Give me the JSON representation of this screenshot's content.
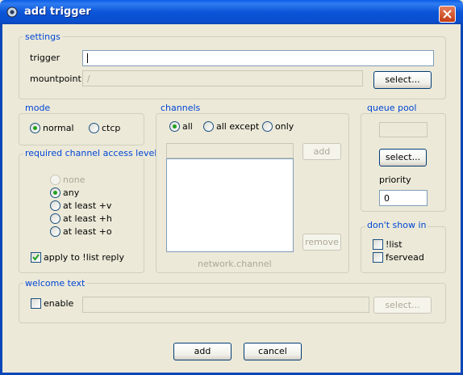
{
  "window": {
    "title": "add trigger"
  },
  "settings": {
    "legend": "settings",
    "trigger_label": "trigger",
    "trigger_value": "",
    "mountpoint_label": "mountpoint",
    "mountpoint_value": "/",
    "select_label": "select..."
  },
  "mode": {
    "legend": "mode",
    "options": [
      {
        "label": "normal",
        "selected": true
      },
      {
        "label": "ctcp",
        "selected": false
      }
    ]
  },
  "access": {
    "legend": "required channel access level",
    "options": [
      {
        "label": "none",
        "selected": false,
        "enabled": false
      },
      {
        "label": "any",
        "selected": true,
        "enabled": true
      },
      {
        "label": "at least +v",
        "selected": false,
        "enabled": true
      },
      {
        "label": "at least +h",
        "selected": false,
        "enabled": true
      },
      {
        "label": "at least +o",
        "selected": false,
        "enabled": true
      }
    ],
    "apply_label": "apply to !list reply",
    "apply_checked": true
  },
  "channels": {
    "legend": "channels",
    "options": [
      {
        "label": "all",
        "selected": true
      },
      {
        "label": "all except",
        "selected": false
      },
      {
        "label": "only",
        "selected": false
      }
    ],
    "add_label": "add",
    "remove_label": "remove",
    "hint": "network.channel"
  },
  "queue_pool": {
    "legend": "queue pool",
    "select_label": "select...",
    "priority_label": "priority",
    "priority_value": "0"
  },
  "dont_show": {
    "legend": "don't show in",
    "items": [
      {
        "label": "!list",
        "checked": false
      },
      {
        "label": "fservead",
        "checked": false
      }
    ]
  },
  "welcome": {
    "legend": "welcome text",
    "enable_label": "enable",
    "enable_checked": false,
    "select_label": "select..."
  },
  "footer": {
    "add_label": "add",
    "cancel_label": "cancel"
  },
  "colors": {
    "title_bar": "#0a5de6",
    "legend_text": "#0046d5",
    "dialog_bg": "#ece9d8",
    "radio_dot": "#21a121"
  }
}
